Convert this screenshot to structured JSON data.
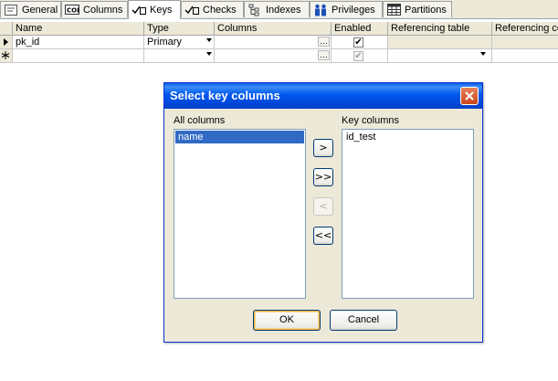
{
  "tabs": [
    {
      "label": "General",
      "icon": "general-icon"
    },
    {
      "label": "Columns",
      "icon": "columns-icon"
    },
    {
      "label": "Keys",
      "icon": "keys-icon",
      "active": true
    },
    {
      "label": "Checks",
      "icon": "checks-icon"
    },
    {
      "label": "Indexes",
      "icon": "indexes-icon"
    },
    {
      "label": "Privileges",
      "icon": "privileges-icon"
    },
    {
      "label": "Partitions",
      "icon": "partitions-icon"
    }
  ],
  "grid": {
    "columns": [
      "Name",
      "Type",
      "Columns",
      "Enabled",
      "Referencing table",
      "Referencing co"
    ],
    "rows": [
      {
        "name": "pk_id",
        "type": "Primary",
        "columns": "",
        "enabled": true,
        "ref_table": "",
        "ref_cols": ""
      }
    ],
    "new_row": {
      "name": "",
      "type": "",
      "columns": "",
      "enabled": true
    }
  },
  "dialog": {
    "title": "Select key columns",
    "all_columns_label": "All columns",
    "key_columns_label": "Key columns",
    "all_columns": [
      "name"
    ],
    "key_columns": [
      "id_test"
    ],
    "buttons": {
      "add": ">",
      "add_all": ">>",
      "remove": "<",
      "remove_all": "<<",
      "ok": "OK",
      "cancel": "Cancel"
    }
  },
  "colors": {
    "title_bar": "#0058ee",
    "selection": "#316ac5",
    "close_button": "#d8592f"
  }
}
